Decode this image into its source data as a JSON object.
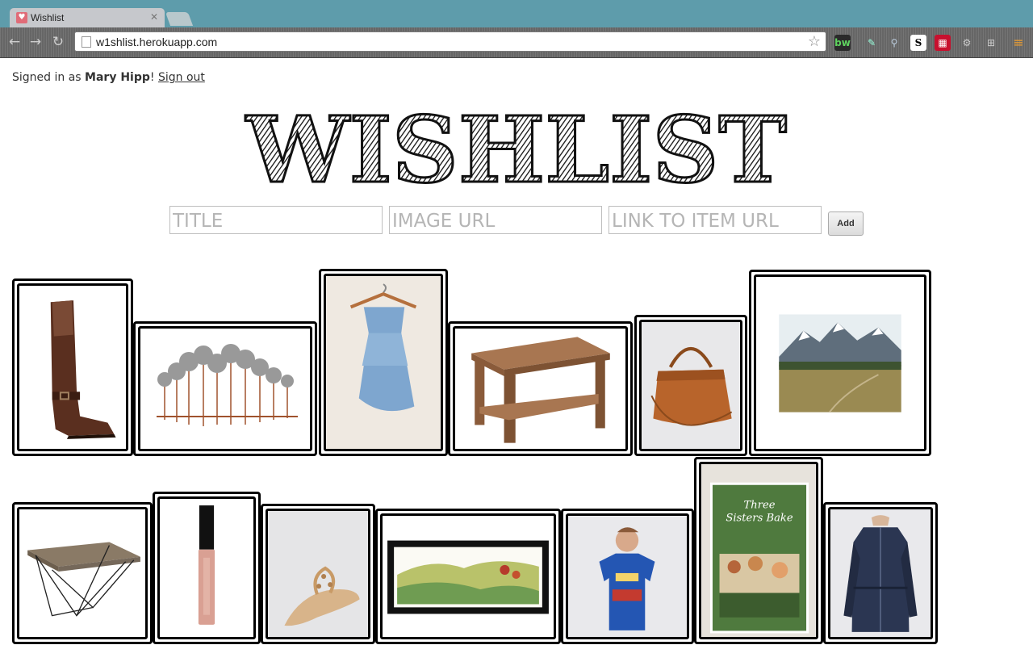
{
  "browser": {
    "tab_title": "Wishlist",
    "url": "w1shlist.herokuapp.com"
  },
  "user": {
    "prefix": "Signed in as ",
    "name": "Mary Hipp",
    "exclamation": "!",
    "sign_out": "Sign out"
  },
  "logo": {
    "text": "WISHLIST"
  },
  "form": {
    "title_placeholder": "TITLE",
    "image_placeholder": "IMAGE URL",
    "link_placeholder": "LINK TO ITEM URL",
    "add_label": "Add"
  },
  "items": [
    {
      "name": "brown-leather-boot",
      "icon": "boot"
    },
    {
      "name": "metal-tree-wall-art",
      "icon": "trees"
    },
    {
      "name": "blue-camisole-on-hanger",
      "icon": "camisole"
    },
    {
      "name": "wooden-side-table",
      "icon": "table"
    },
    {
      "name": "cognac-leather-handbag",
      "icon": "handbag"
    },
    {
      "name": "mountain-landscape-print",
      "icon": "landscape"
    },
    {
      "name": "wood-and-wire-coffee-table",
      "icon": "coffee-table"
    },
    {
      "name": "lip-gloss-tube",
      "icon": "lip-gloss"
    },
    {
      "name": "beaded-sandal",
      "icon": "sandal"
    },
    {
      "name": "watercolor-landscape-print",
      "icon": "watercolor"
    },
    {
      "name": "great-gatsby-tshirt",
      "icon": "tshirt"
    },
    {
      "name": "three-sisters-bake-cookbook",
      "icon": "book",
      "caption_line1": "Three",
      "caption_line2": "Sisters Bake"
    },
    {
      "name": "navy-trench-jacket",
      "icon": "jacket"
    }
  ]
}
